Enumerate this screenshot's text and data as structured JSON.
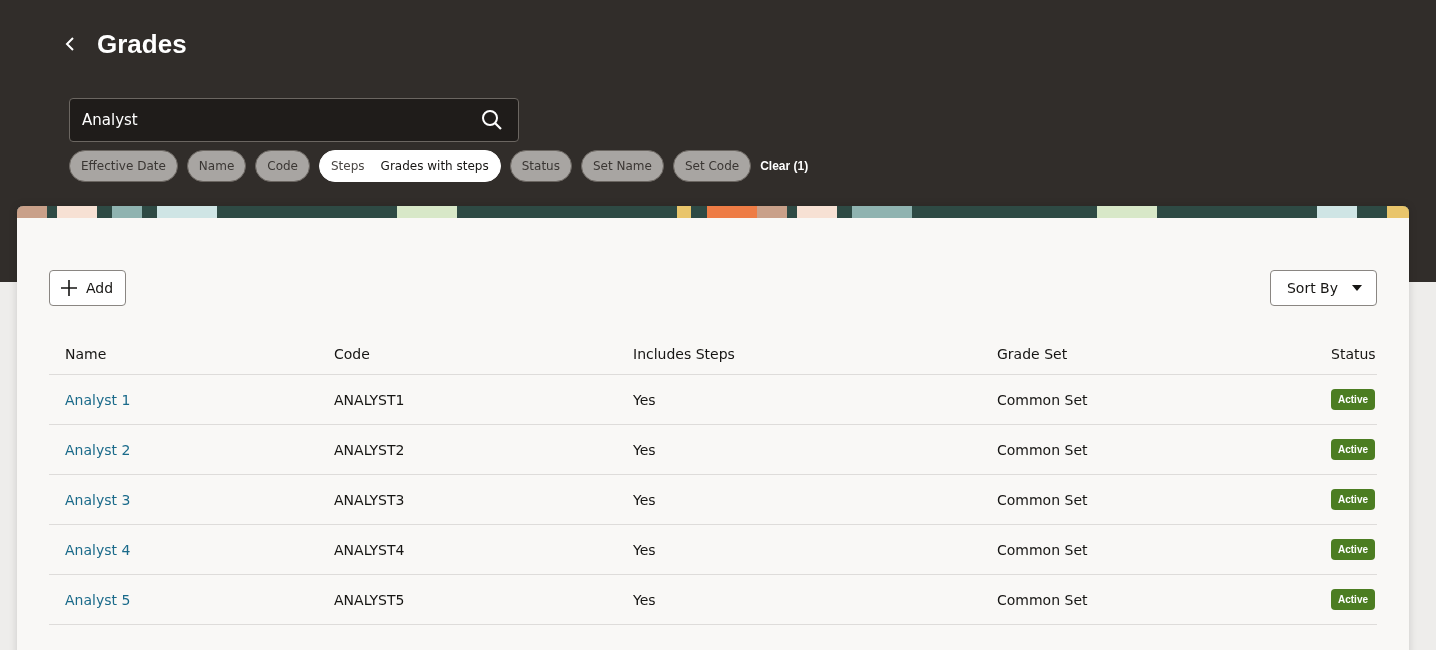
{
  "header": {
    "title": "Grades"
  },
  "search": {
    "value": "Analyst"
  },
  "filters": [
    {
      "label": "Effective Date",
      "selected": false
    },
    {
      "label": "Name",
      "selected": false
    },
    {
      "label": "Code",
      "selected": false
    },
    {
      "label": "Steps",
      "value": "Grades with steps",
      "selected": true
    },
    {
      "label": "Status",
      "selected": false
    },
    {
      "label": "Set Name",
      "selected": false
    },
    {
      "label": "Set Code",
      "selected": false
    }
  ],
  "clear_link": "Clear (1)",
  "toolbar": {
    "add_button": "Add",
    "sort_button": "Sort By"
  },
  "table": {
    "columns": [
      "Name",
      "Code",
      "Includes Steps",
      "Grade Set",
      "Status"
    ],
    "rows": [
      {
        "name": "Analyst 1",
        "code": "ANALYST1",
        "includes_steps": "Yes",
        "grade_set": "Common Set",
        "status": "Active"
      },
      {
        "name": "Analyst 2",
        "code": "ANALYST2",
        "includes_steps": "Yes",
        "grade_set": "Common Set",
        "status": "Active"
      },
      {
        "name": "Analyst 3",
        "code": "ANALYST3",
        "includes_steps": "Yes",
        "grade_set": "Common Set",
        "status": "Active"
      },
      {
        "name": "Analyst 4",
        "code": "ANALYST4",
        "includes_steps": "Yes",
        "grade_set": "Common Set",
        "status": "Active"
      },
      {
        "name": "Analyst 5",
        "code": "ANALYST5",
        "includes_steps": "Yes",
        "grade_set": "Common Set",
        "status": "Active"
      }
    ]
  }
}
